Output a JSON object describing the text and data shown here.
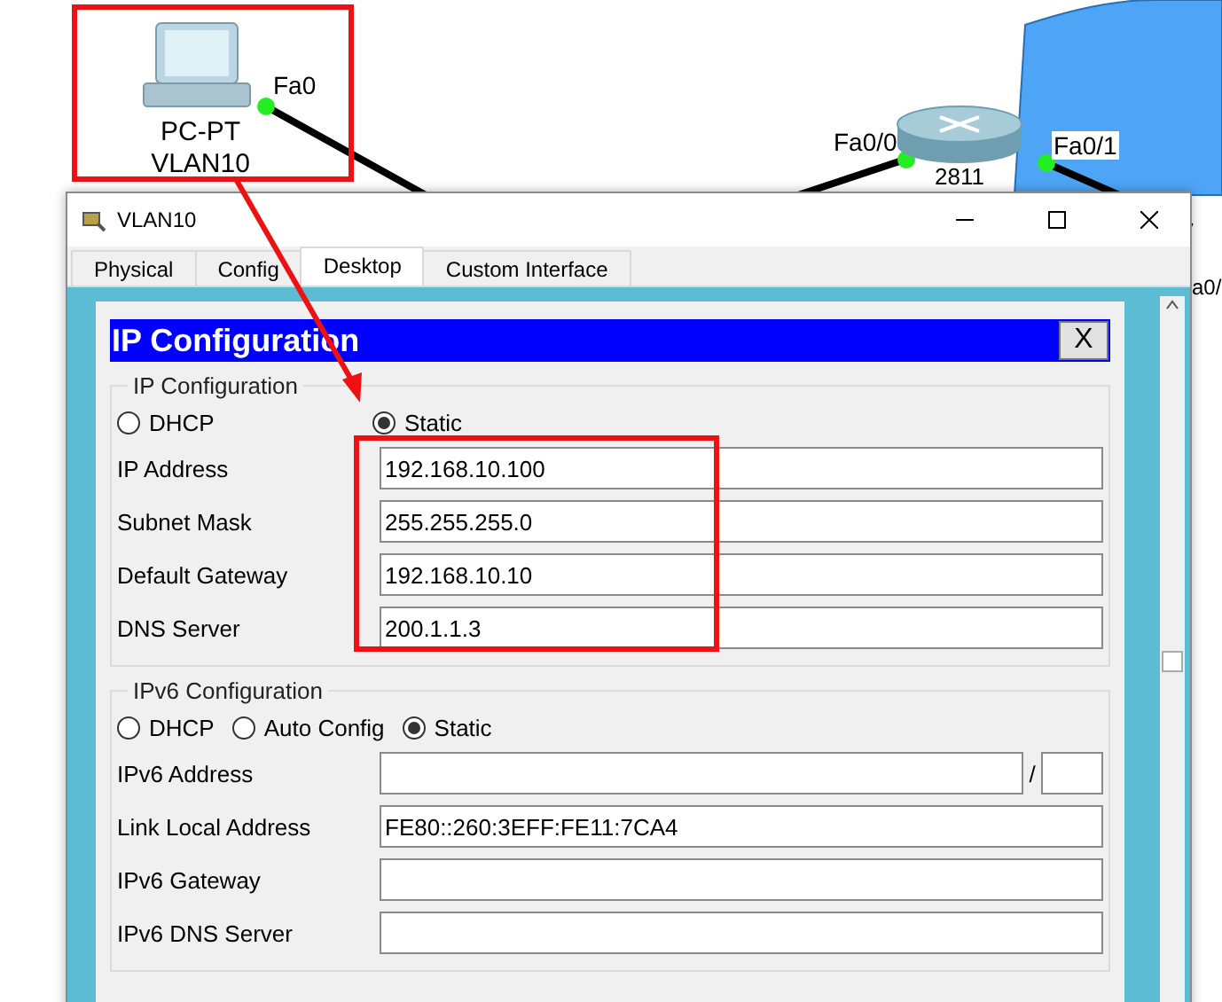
{
  "canvas": {
    "devices": [
      {
        "kind": "pc",
        "labels": [
          "PC-PT",
          "VLAN10"
        ]
      },
      {
        "kind": "router",
        "labels": [
          "2811"
        ]
      }
    ],
    "port_labels": [
      "Fa0",
      "Fa0/0",
      "Fa0/1",
      "a0/"
    ]
  },
  "window": {
    "title": "VLAN10",
    "tabs": [
      {
        "label": "Physical",
        "selected": false
      },
      {
        "label": "Config",
        "selected": false
      },
      {
        "label": "Desktop",
        "selected": true
      },
      {
        "label": "Custom Interface",
        "selected": false
      }
    ]
  },
  "ip_config": {
    "title": "IP Configuration",
    "close": "X",
    "ipv4": {
      "legend": "IP Configuration",
      "modes": [
        {
          "label": "DHCP",
          "selected": false
        },
        {
          "label": "Static",
          "selected": true
        }
      ],
      "fields": [
        {
          "kind": "plain",
          "label": "IP Address",
          "value": "192.168.10.100"
        },
        {
          "kind": "plain",
          "label": "Subnet Mask",
          "value": "255.255.255.0"
        },
        {
          "kind": "plain",
          "label": "Default Gateway",
          "value": "192.168.10.10"
        },
        {
          "kind": "plain",
          "label": "DNS Server",
          "value": "200.1.1.3"
        }
      ]
    },
    "ipv6": {
      "legend": "IPv6 Configuration",
      "modes": [
        {
          "label": "DHCP",
          "selected": false
        },
        {
          "label": "Auto Config",
          "selected": false
        },
        {
          "label": "Static",
          "selected": true
        }
      ],
      "fields": [
        {
          "kind": "prefixed",
          "label": "IPv6 Address",
          "separator": "/"
        },
        {
          "kind": "plain",
          "label": "Link Local Address",
          "value": "FE80::260:3EFF:FE11:7CA4"
        },
        {
          "kind": "plain",
          "label": "IPv6 Gateway"
        },
        {
          "kind": "plain",
          "label": "IPv6 DNS Server"
        }
      ]
    }
  }
}
